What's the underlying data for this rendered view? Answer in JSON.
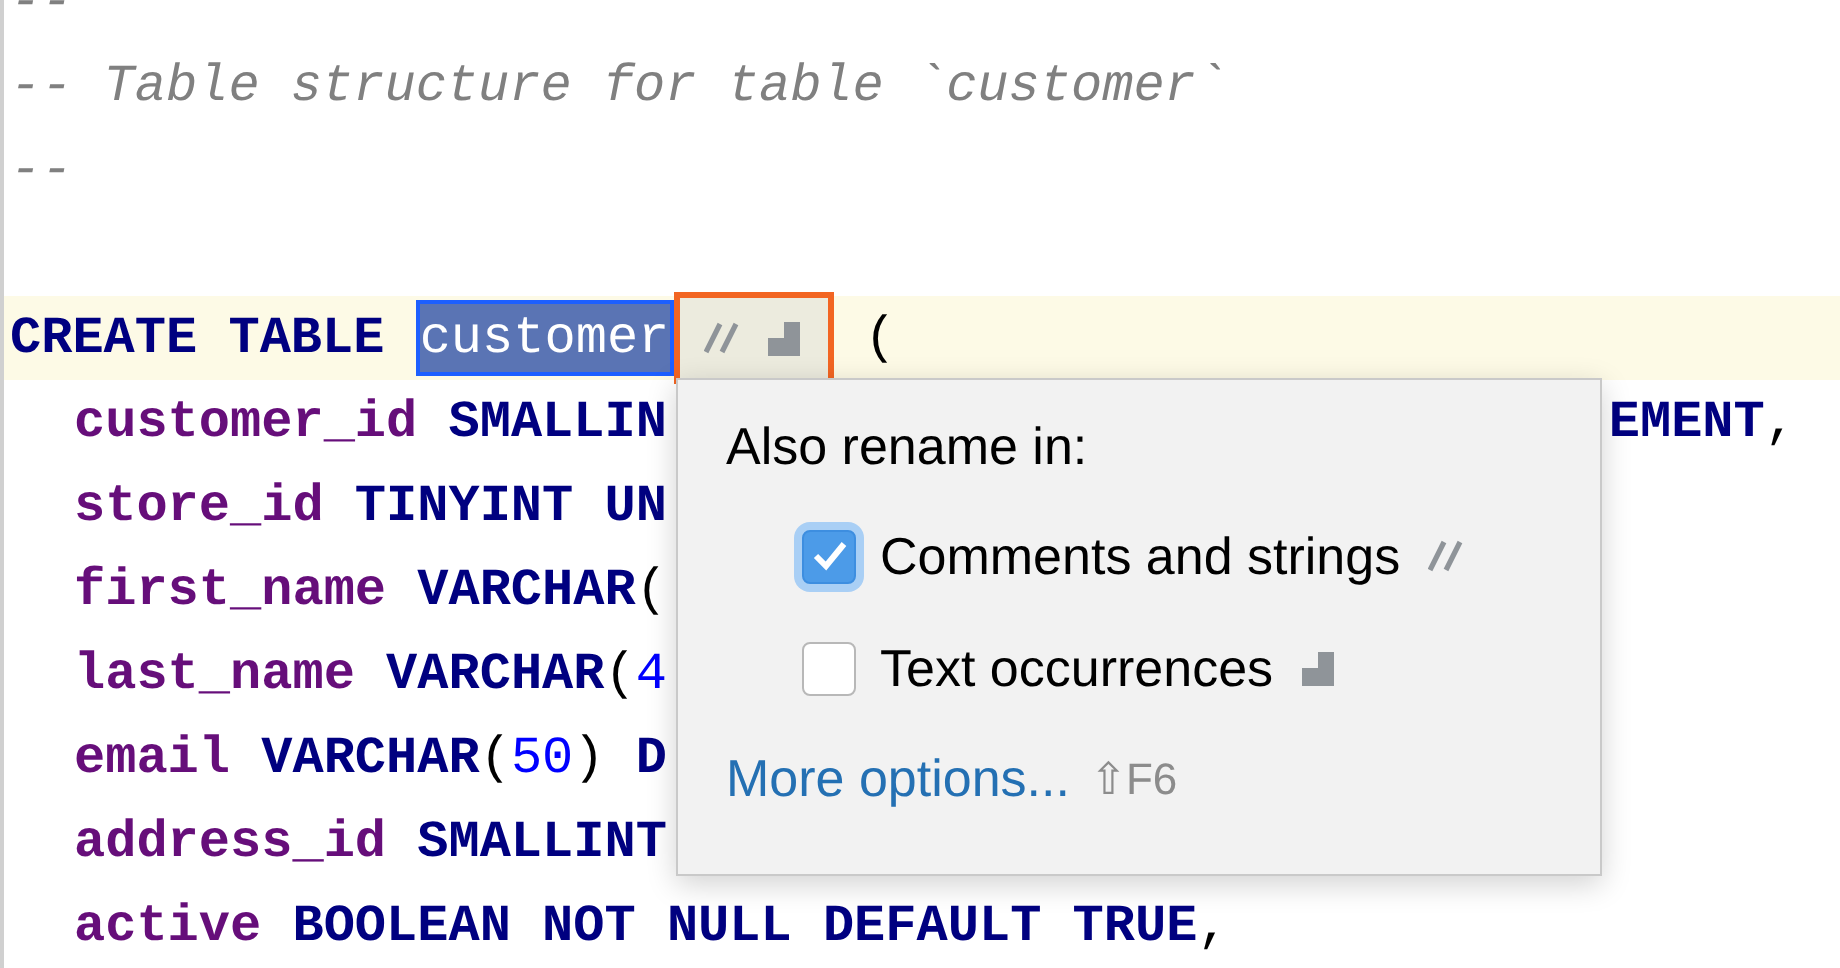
{
  "lines": [
    {
      "kind": "code",
      "words": [
        [
          {
            "kind": "comment",
            "text": "--"
          }
        ]
      ]
    },
    {
      "kind": "code",
      "words": [
        [
          {
            "kind": "comment",
            "text": "-- Table structure for table `customer`"
          }
        ]
      ]
    },
    {
      "kind": "code",
      "words": [
        [
          {
            "kind": "comment",
            "text": "--"
          }
        ]
      ]
    },
    {
      "kind": "blank"
    },
    {
      "kind": "code",
      "current": true,
      "words": [
        [
          {
            "kind": "keyword",
            "text": "CREATE"
          }
        ],
        [
          {
            "kind": "keyword",
            "text": "TABLE"
          }
        ],
        [
          {
            "kind": "selection",
            "text": "customer"
          },
          {
            "kind": "inlay"
          }
        ],
        [
          {
            "kind": "punct",
            "text": "("
          }
        ]
      ],
      "children": [
        {
          "kind": "code",
          "words": [
            [
              {
                "kind": "field",
                "text": "customer_id"
              }
            ],
            [
              {
                "kind": "keyword",
                "text": "SMALLIN"
              }
            ]
          ],
          "tail": [
            [
              {
                "kind": "keyword",
                "text": "EMENT"
              },
              {
                "kind": "punct",
                "text": ","
              }
            ]
          ]
        },
        {
          "kind": "code",
          "words": [
            [
              {
                "kind": "field",
                "text": "store_id"
              }
            ],
            [
              {
                "kind": "keyword",
                "text": "TINYINT"
              }
            ],
            [
              {
                "kind": "keyword",
                "text": "UN"
              }
            ]
          ]
        },
        {
          "kind": "code",
          "words": [
            [
              {
                "kind": "field",
                "text": "first_name"
              }
            ],
            [
              {
                "kind": "keyword",
                "text": "VARCHAR"
              },
              {
                "kind": "punct",
                "text": "("
              }
            ]
          ]
        },
        {
          "kind": "code",
          "words": [
            [
              {
                "kind": "field",
                "text": "last_name"
              }
            ],
            [
              {
                "kind": "keyword",
                "text": "VARCHAR"
              },
              {
                "kind": "punct",
                "text": "("
              },
              {
                "kind": "number",
                "text": "4"
              }
            ]
          ]
        },
        {
          "kind": "code",
          "words": [
            [
              {
                "kind": "field",
                "text": "email"
              }
            ],
            [
              {
                "kind": "keyword",
                "text": "VARCHAR"
              },
              {
                "kind": "punct",
                "text": "("
              },
              {
                "kind": "number",
                "text": "50"
              },
              {
                "kind": "punct",
                "text": ")"
              }
            ],
            [
              {
                "kind": "keyword",
                "text": "D"
              }
            ]
          ]
        },
        {
          "kind": "code",
          "words": [
            [
              {
                "kind": "field",
                "text": "address_id"
              }
            ],
            [
              {
                "kind": "keyword",
                "text": "SMALLINT"
              }
            ]
          ]
        },
        {
          "kind": "code",
          "words": [
            [
              {
                "kind": "field",
                "text": "active"
              }
            ],
            [
              {
                "kind": "keyword",
                "text": "BOOLEAN"
              }
            ],
            [
              {
                "kind": "keyword",
                "text": "NOT"
              }
            ],
            [
              {
                "kind": "keyword",
                "text": "NULL"
              }
            ],
            [
              {
                "kind": "keyword",
                "text": "DEFAULT"
              }
            ],
            [
              {
                "kind": "keyword",
                "text": "TRUE"
              },
              {
                "kind": "punct",
                "text": ","
              }
            ]
          ]
        }
      ]
    }
  ],
  "popup": {
    "title": "Also rename in:",
    "options": [
      {
        "label": "Comments and strings",
        "checked": true,
        "focused": true,
        "kind": "comments"
      },
      {
        "label": "Text occurrences",
        "checked": false,
        "focused": false,
        "kind": "text"
      }
    ],
    "link": "More options...",
    "shortcut": "⇧F6"
  }
}
